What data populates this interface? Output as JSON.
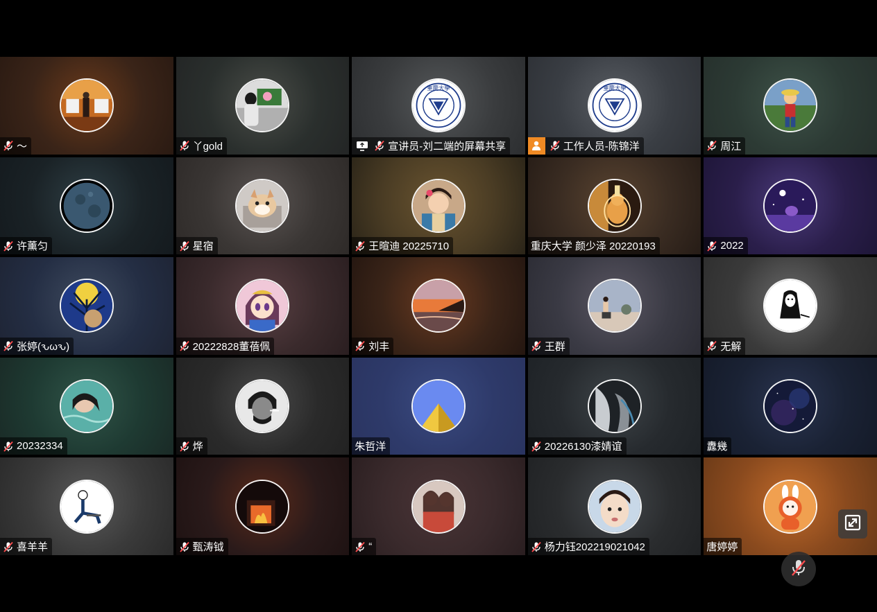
{
  "participants": [
    {
      "name": "～",
      "muted": true,
      "badge": "",
      "bg": [
        "#3a2418",
        "#6b3a1a",
        "#2a1a12"
      ],
      "avatar": "autumn-photo"
    },
    {
      "name": "丫gold",
      "muted": true,
      "badge": "",
      "bg": [
        "#2a2f2d",
        "#4a4d48",
        "#232525"
      ],
      "avatar": "tv-room-photo"
    },
    {
      "name": "宣讲员-刘二端的屏幕共享",
      "muted": true,
      "badge": "screen-share",
      "bg": [
        "#3a3c3e",
        "#55585a",
        "#2c2e30"
      ],
      "avatar": "university-logo"
    },
    {
      "name": "工作人员-陈锦洋",
      "muted": true,
      "badge": "host",
      "bg": [
        "#3a3e44",
        "#5a5e64",
        "#2e3136"
      ],
      "avatar": "university-logo"
    },
    {
      "name": "周江",
      "muted": true,
      "badge": "",
      "bg": [
        "#2c3a34",
        "#3e5248",
        "#26302c"
      ],
      "avatar": "anime-pirate"
    },
    {
      "name": "许薰匀",
      "muted": true,
      "badge": "",
      "bg": [
        "#1a2226",
        "#2e3e44",
        "#141a1e"
      ],
      "avatar": "moon"
    },
    {
      "name": "星宿",
      "muted": true,
      "badge": "",
      "bg": [
        "#3a3634",
        "#5a5452",
        "#2e2a28"
      ],
      "avatar": "shiba-dog"
    },
    {
      "name": "王暄迪 20225710",
      "muted": true,
      "badge": "",
      "bg": [
        "#4a3c24",
        "#6a5430",
        "#2a2418"
      ],
      "avatar": "costume-girl"
    },
    {
      "name": "重庆大学 颜少泽 20220193",
      "muted": false,
      "badge": "",
      "bg": [
        "#3a2c22",
        "#5a4430",
        "#261c16"
      ],
      "avatar": "glowing-cat"
    },
    {
      "name": "2022",
      "muted": true,
      "badge": "",
      "bg": [
        "#2a1e4a",
        "#4a3a7a",
        "#1e1638"
      ],
      "avatar": "purple-night"
    },
    {
      "name": "张婷(ԅωԅ)",
      "muted": true,
      "badge": "",
      "bg": [
        "#242e44",
        "#3e4a5e",
        "#1e2434"
      ],
      "avatar": "blue-tree"
    },
    {
      "name": "20222828董蓓佩",
      "muted": true,
      "badge": "",
      "bg": [
        "#3a2a2c",
        "#5a4044",
        "#2a1e20"
      ],
      "avatar": "anime-girl"
    },
    {
      "name": "刘丰",
      "muted": true,
      "badge": "",
      "bg": [
        "#3a2418",
        "#6a3a20",
        "#241610"
      ],
      "avatar": "sunset-sea"
    },
    {
      "name": "王群",
      "muted": true,
      "badge": "",
      "bg": [
        "#3a3a44",
        "#5a5662",
        "#2c2c34"
      ],
      "avatar": "beach-person"
    },
    {
      "name": "无解",
      "muted": true,
      "badge": "",
      "bg": [
        "#3a3a3a",
        "#6a6a6a",
        "#2e2e2e"
      ],
      "avatar": "no-face"
    },
    {
      "name": "20232334",
      "muted": true,
      "badge": "",
      "bg": [
        "#1e3a32",
        "#305448",
        "#1a2a26"
      ],
      "avatar": "water-girl"
    },
    {
      "name": "烨",
      "muted": true,
      "badge": "",
      "bg": [
        "#2a2a2a",
        "#4a4a4a",
        "#222222"
      ],
      "avatar": "bw-portrait"
    },
    {
      "name": "朱哲洋",
      "muted": false,
      "badge": "",
      "bg": [
        "#2e3a6a",
        "#3a4a80",
        "#2a3460"
      ],
      "avatar": "pyramid"
    },
    {
      "name": "20226130漆婧谊",
      "muted": true,
      "badge": "",
      "bg": [
        "#262a2e",
        "#3e4448",
        "#1e2226"
      ],
      "avatar": "grey-fabric"
    },
    {
      "name": "纛幾",
      "muted": false,
      "badge": "",
      "bg": [
        "#1a2234",
        "#2a3450",
        "#141a28"
      ],
      "avatar": "galaxy"
    },
    {
      "name": "喜羊羊",
      "muted": true,
      "badge": "",
      "bg": [
        "#3a3a3a",
        "#5a5a5a",
        "#2a2a2a"
      ],
      "avatar": "sketch-man"
    },
    {
      "name": "甄涛钺",
      "muted": true,
      "badge": "",
      "bg": [
        "#2a1a1a",
        "#5a2a1a",
        "#1e1212"
      ],
      "avatar": "fireplace"
    },
    {
      "name": "“",
      "muted": true,
      "badge": "",
      "bg": [
        "#3a2a2c",
        "#4a3436",
        "#2a1e20"
      ],
      "avatar": "two-girls"
    },
    {
      "name": "杨力钰202219021042",
      "muted": true,
      "badge": "",
      "bg": [
        "#2a2c2e",
        "#44484c",
        "#202224"
      ],
      "avatar": "child-face"
    },
    {
      "name": "唐婷婷",
      "muted": false,
      "badge": "",
      "bg": [
        "#8a4a1e",
        "#c06a2a",
        "#6a3a18"
      ],
      "avatar": "bunny-toy"
    }
  ],
  "controls": {
    "expand_icon": "expand-icon",
    "self_mic_icon": "mic-off-icon"
  },
  "colors": {
    "page_bg": "#000000",
    "host_badge": "#f08a24",
    "mic_muted": "#ff4d4f"
  }
}
